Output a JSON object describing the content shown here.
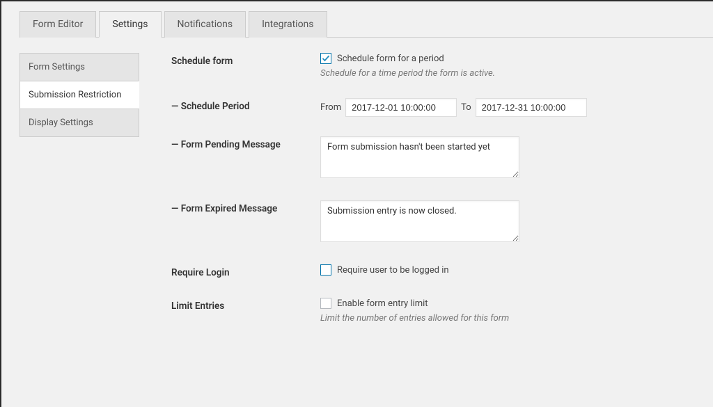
{
  "tabs": {
    "editor": "Form Editor",
    "settings": "Settings",
    "notifications": "Notifications",
    "integrations": "Integrations"
  },
  "side": {
    "form_settings": "Form Settings",
    "submission_restriction": "Submission Restriction",
    "display_settings": "Display Settings"
  },
  "schedule": {
    "label": "Schedule form",
    "checkbox_label": "Schedule form for a period",
    "hint": "Schedule for a time period the form is active.",
    "period_label": "— Schedule Period",
    "from_label": "From",
    "from_value": "2017-12-01 10:00:00",
    "to_label": "To",
    "to_value": "2017-12-31 10:00:00",
    "pending_label": "— Form Pending Message",
    "pending_value": "Form submission hasn't been started yet",
    "expired_label": "— Form Expired Message",
    "expired_value": "Submission entry is now closed."
  },
  "require_login": {
    "label": "Require Login",
    "checkbox_label": "Require user to be logged in"
  },
  "limit": {
    "label": "Limit Entries",
    "checkbox_label": "Enable form entry limit",
    "hint": "Limit the number of entries allowed for this form"
  }
}
